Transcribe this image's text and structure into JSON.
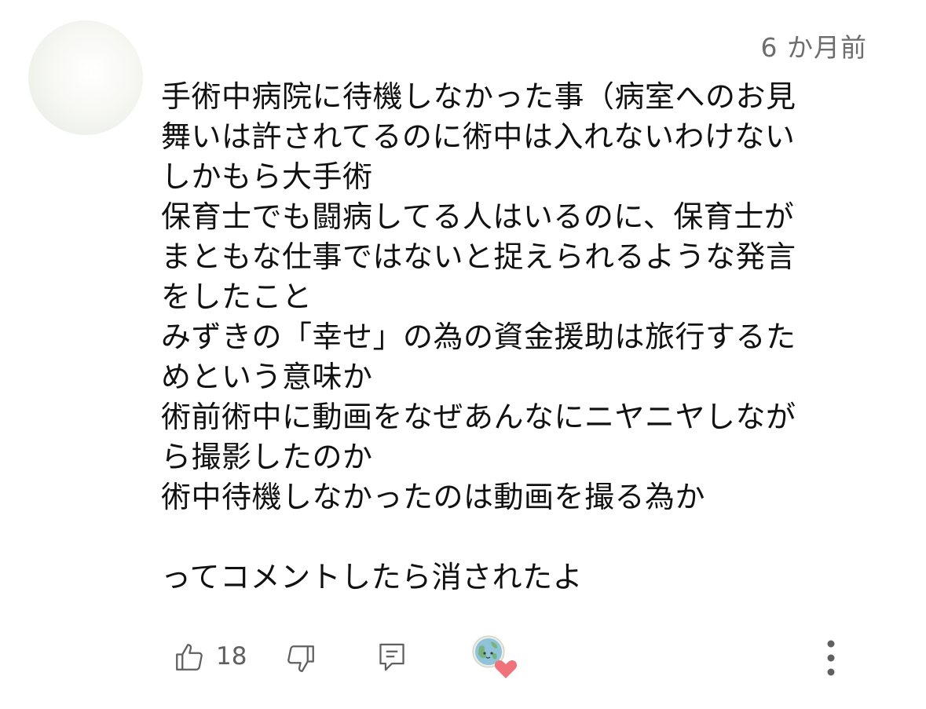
{
  "comment": {
    "author_name": "",
    "timestamp": "6 か月前",
    "text": "手術中病院に待機しなかった事（病室へのお見\n舞いは許されてるのに術中は入れないわけない\nしかもら大手術\n保育士でも闘病してる人はいるのに、保育士が\nまともな仕事ではないと捉えられるような発言\nをしたこと\nみずきの「幸せ」の為の資金援助は旅行するた\nめという意味か\n術前術中に動画をなぜあんなにニヤニヤしなが\nら撮影したのか\n術中待機しなかったのは動画を撮る為か\n\nってコメントしたら消されたよ"
  },
  "actions": {
    "like_icon": "thumbs-up-icon",
    "like_count": "18",
    "dislike_icon": "thumbs-down-icon",
    "reply_icon": "reply-icon",
    "creator_heart_icon": "creator-heart-icon",
    "more_icon": "more-vertical-icon"
  },
  "colors": {
    "text": "#111111",
    "secondary_text": "#6d6d6d",
    "icon": "#606060",
    "heart": "#f0737b"
  }
}
